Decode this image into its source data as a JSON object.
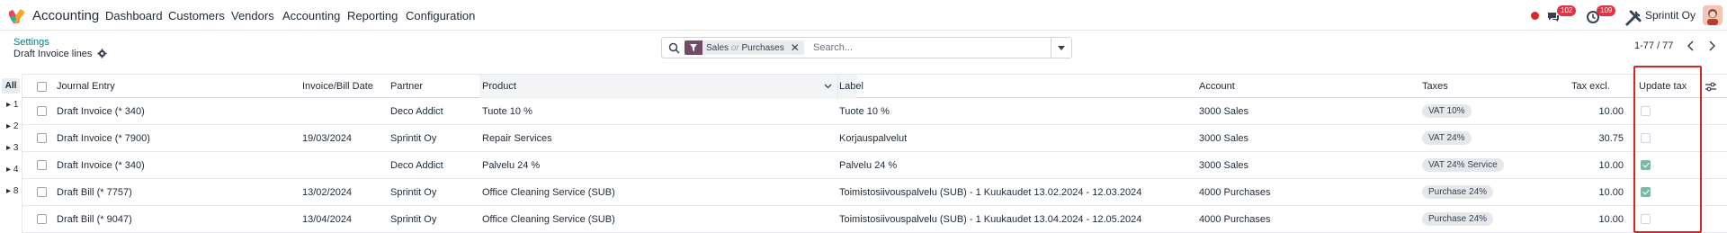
{
  "navbar": {
    "app_name": "Accounting",
    "menu": [
      "Dashboard",
      "Customers",
      "Vendors",
      "Accounting",
      "Reporting",
      "Configuration"
    ],
    "messages_badge": "102",
    "activities_badge": "109",
    "company": "Sprintit Oy"
  },
  "control_panel": {
    "breadcrumb": "Settings",
    "title": "Draft Invoice lines",
    "search": {
      "facet_first": "Sales",
      "facet_or": "or",
      "facet_second": "Purchases",
      "placeholder": "Search..."
    },
    "pager": "1-77 / 77"
  },
  "group_panel": {
    "all_label": "All",
    "groups": [
      "1",
      "2",
      "3",
      "4",
      "8"
    ]
  },
  "table": {
    "columns": {
      "journal_entry": "Journal Entry",
      "invoice_date": "Invoice/Bill Date",
      "partner": "Partner",
      "product": "Product",
      "label": "Label",
      "account": "Account",
      "taxes": "Taxes",
      "tax_excl": "Tax excl.",
      "update_tax": "Update tax"
    },
    "rows": [
      {
        "journal_entry": "Draft Invoice (* 340)",
        "date": "",
        "partner": "Deco Addict",
        "product": "Tuote 10 %",
        "label": "Tuote 10 %",
        "account": "3000 Sales",
        "taxes": "VAT 10%",
        "tax_excl": "10.00",
        "update_tax": false
      },
      {
        "journal_entry": "Draft Invoice (* 7900)",
        "date": "19/03/2024",
        "partner": "Sprintit Oy",
        "product": "Repair Services",
        "label": "Korjauspalvelut",
        "account": "3000 Sales",
        "taxes": "VAT 24%",
        "tax_excl": "30.75",
        "update_tax": false
      },
      {
        "journal_entry": "Draft Invoice (* 340)",
        "date": "",
        "partner": "Deco Addict",
        "product": "Palvelu 24 %",
        "label": "Palvelu 24 %",
        "account": "3000 Sales",
        "taxes": "VAT 24% Service",
        "tax_excl": "10.00",
        "update_tax": true
      },
      {
        "journal_entry": "Draft Bill (* 7757)",
        "date": "13/02/2024",
        "partner": "Sprintit Oy",
        "product": "Office Cleaning Service (SUB)",
        "label": "Toimistosiivouspalvelu (SUB) - 1 Kuukaudet 13.02.2024 - 12.03.2024",
        "account": "4000 Purchases",
        "taxes": "Purchase 24%",
        "tax_excl": "10.00",
        "update_tax": true
      },
      {
        "journal_entry": "Draft Bill (* 9047)",
        "date": "13/04/2024",
        "partner": "Sprintit Oy",
        "product": "Office Cleaning Service (SUB)",
        "label": "Toimistosiivouspalvelu (SUB) - 1 Kuukaudet 13.04.2024 - 12.05.2024",
        "account": "4000 Purchases",
        "taxes": "Purchase 24%",
        "tax_excl": "10.00",
        "update_tax": false
      }
    ]
  },
  "colors": {
    "brand": "#714b67",
    "link": "#017e84",
    "badge": "#dc3545",
    "highlight": "#dc2626",
    "checked": "#7fb7a6"
  }
}
